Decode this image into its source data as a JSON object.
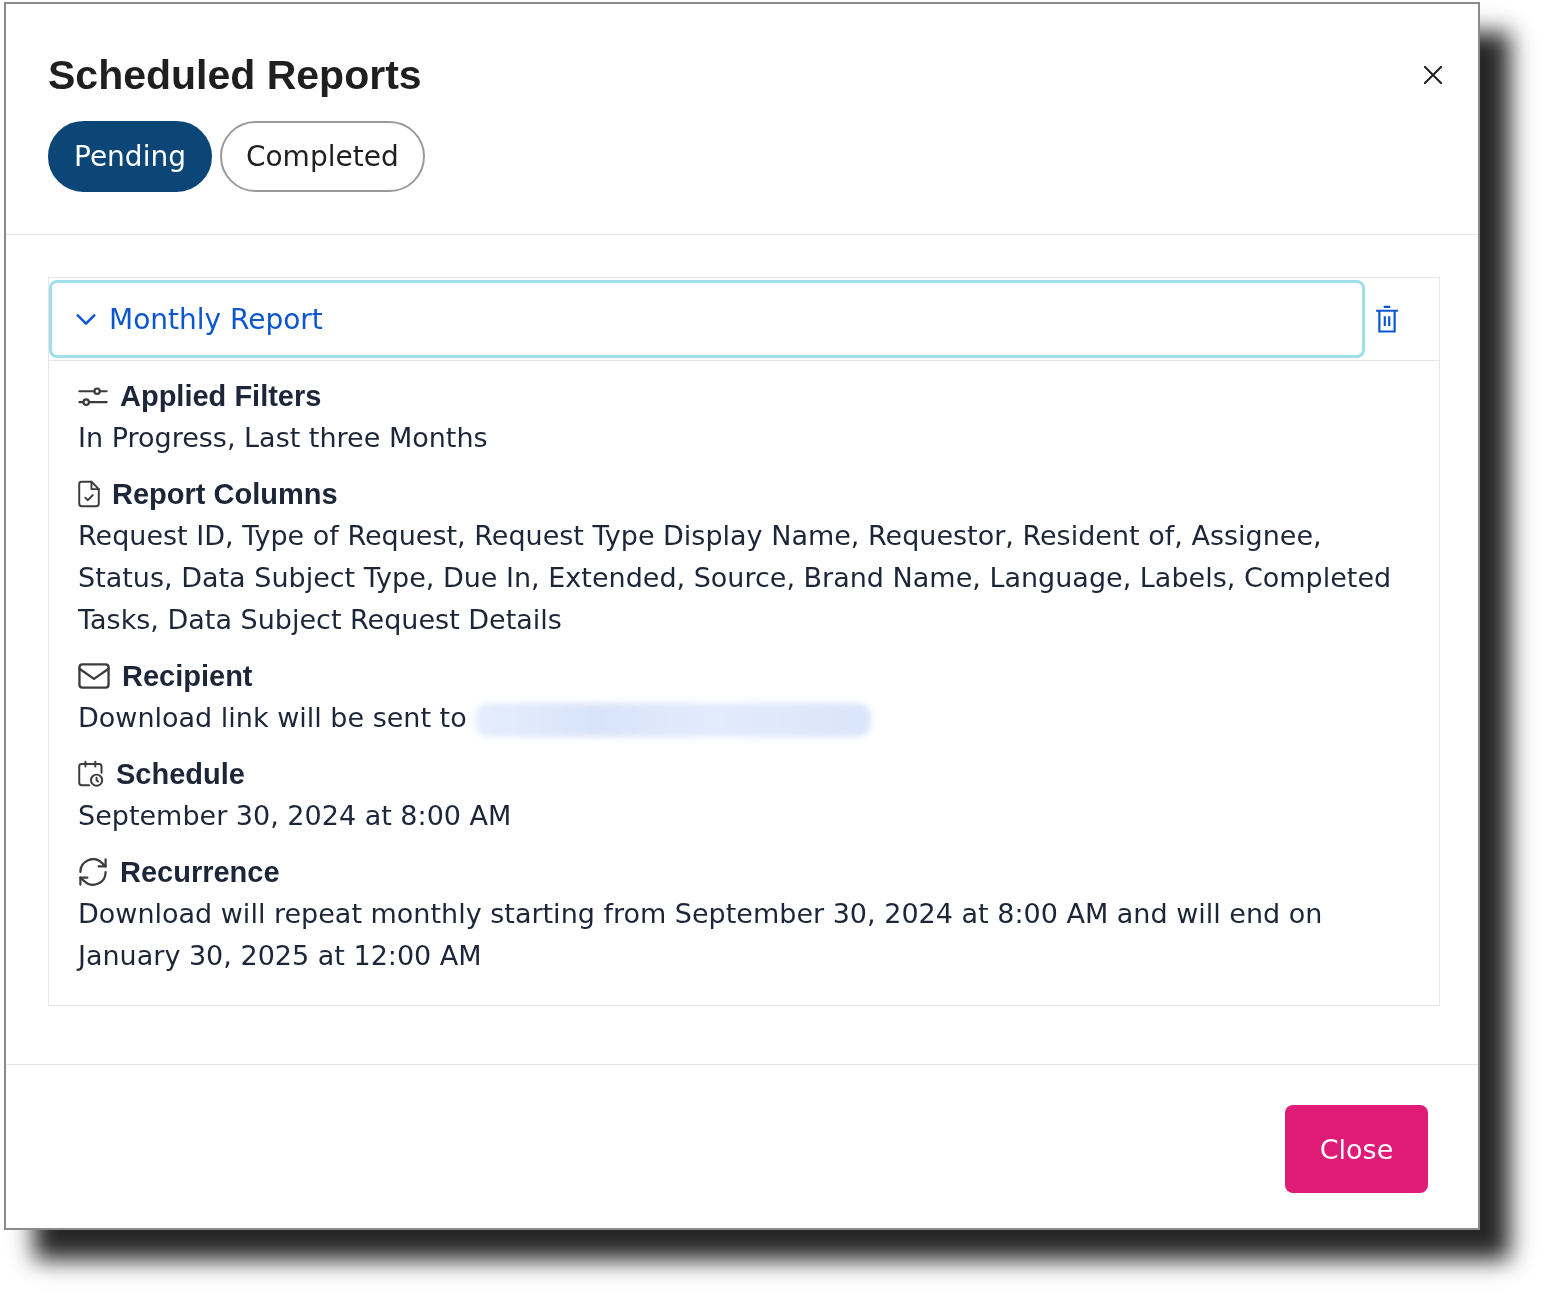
{
  "dialog": {
    "title": "Scheduled Reports"
  },
  "tabs": [
    {
      "label": "Pending",
      "selected": true
    },
    {
      "label": "Completed",
      "selected": false
    }
  ],
  "reports": [
    {
      "title": "Monthly Report",
      "expanded": true,
      "focused": true,
      "sections": [
        {
          "kind": "filters",
          "heading": "Applied Filters",
          "text": "In Progress, Last three Months"
        },
        {
          "kind": "columns",
          "heading": "Report Columns",
          "text": "Request ID, Type of Request, Request Type Display Name, Requestor, Resident of, Assignee, Status, Data Subject Type, Due In, Extended, Source, Brand Name, Language, Labels, Completed Tasks, Data Subject Request Details"
        },
        {
          "kind": "recipient",
          "heading": "Recipient",
          "text": "Download link will be sent to",
          "redacted": true
        },
        {
          "kind": "schedule",
          "heading": "Schedule",
          "text": "September 30, 2024 at 8:00 AM"
        },
        {
          "kind": "recurrence",
          "heading": "Recurrence",
          "text": "Download will repeat monthly starting from September 30, 2024 at 8:00 AM and will end on January 30, 2025 at 12:00 AM"
        }
      ]
    }
  ],
  "footer": {
    "buttons": [
      "Close"
    ]
  }
}
